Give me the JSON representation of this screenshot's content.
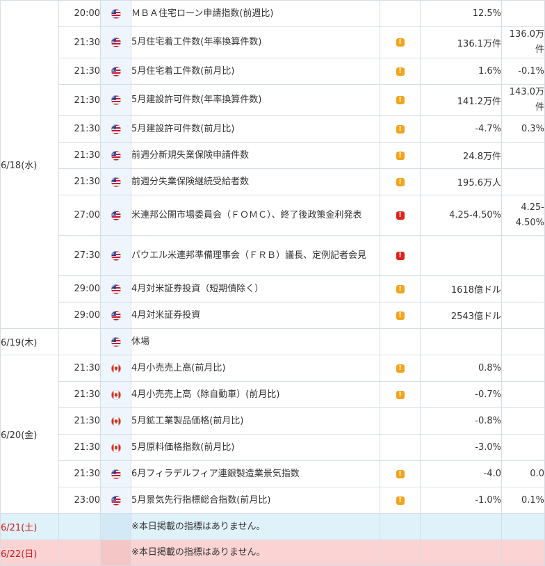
{
  "colors": {
    "border": "#d6dde6",
    "flag_column": "#eef5fc",
    "saturday_bg": "#dff1f9",
    "sunday_bg": "#fbd3d3",
    "weekend_date_text": "#d61a1a",
    "importance_mid": "#f4a31b",
    "importance_high": "#e0221c"
  },
  "rows": [
    {
      "date": "6/18(水)",
      "time": "20:00",
      "country": "us-flag-icon",
      "name": "ＭＢＡ住宅ローン申請指数(前週比)",
      "importance": "",
      "previous": "12.5%",
      "forecast": ""
    },
    {
      "date": "",
      "time": "21:30",
      "country": "us-flag-icon",
      "name": "5月住宅着工件数(年率換算件数)",
      "importance": "mid",
      "previous": "136.1万件",
      "forecast": "136.0万件"
    },
    {
      "date": "",
      "time": "21:30",
      "country": "us-flag-icon",
      "name": "5月住宅着工件数(前月比)",
      "importance": "mid",
      "previous": "1.6%",
      "forecast": "-0.1%"
    },
    {
      "date": "",
      "time": "21:30",
      "country": "us-flag-icon",
      "name": "5月建設許可件数(年率換算件数)",
      "importance": "mid",
      "previous": "141.2万件",
      "forecast": "143.0万件"
    },
    {
      "date": "",
      "time": "21:30",
      "country": "us-flag-icon",
      "name": "5月建設許可件数(前月比)",
      "importance": "mid",
      "previous": "-4.7%",
      "forecast": "0.3%"
    },
    {
      "date": "",
      "time": "21:30",
      "country": "us-flag-icon",
      "name": "前週分新規失業保険申請件数",
      "importance": "mid",
      "previous": "24.8万件",
      "forecast": ""
    },
    {
      "date": "",
      "time": "21:30",
      "country": "us-flag-icon",
      "name": "前週分失業保険継続受給者数",
      "importance": "mid",
      "previous": "195.6万人",
      "forecast": ""
    },
    {
      "date": "",
      "time": "27:00",
      "country": "us-flag-icon",
      "name": "米連邦公開市場委員会（ＦＯＭＣ）、終了後政策金利発表",
      "importance": "high",
      "previous": "4.25-4.50%",
      "forecast": "4.25-4.50%"
    },
    {
      "date": "",
      "time": "27:30",
      "country": "us-flag-icon",
      "name": "パウエル米連邦準備理事会（ＦＲＢ）議長、定例記者会見",
      "importance": "high",
      "previous": "",
      "forecast": ""
    },
    {
      "date": "",
      "time": "29:00",
      "country": "us-flag-icon",
      "name": "4月対米証券投資（短期債除く）",
      "importance": "mid",
      "previous": "1618億ドル",
      "forecast": ""
    },
    {
      "date": "",
      "time": "29:00",
      "country": "us-flag-icon",
      "name": "4月対米証券投資",
      "importance": "mid",
      "previous": "2543億ドル",
      "forecast": ""
    },
    {
      "date": "6/19(木)",
      "time": "",
      "country": "us-flag-icon",
      "name": "休場",
      "importance": "",
      "previous": "",
      "forecast": ""
    },
    {
      "date": "6/20(金)",
      "time": "21:30",
      "country": "ca-flag-icon",
      "name": "4月小売売上高(前月比)",
      "importance": "mid",
      "previous": "0.8%",
      "forecast": ""
    },
    {
      "date": "",
      "time": "21:30",
      "country": "ca-flag-icon",
      "name": "4月小売売上高（除自動車）(前月比)",
      "importance": "mid",
      "previous": "-0.7%",
      "forecast": ""
    },
    {
      "date": "",
      "time": "21:30",
      "country": "ca-flag-icon",
      "name": "5月鉱工業製品価格(前月比)",
      "importance": "",
      "previous": "-0.8%",
      "forecast": ""
    },
    {
      "date": "",
      "time": "21:30",
      "country": "ca-flag-icon",
      "name": "5月原料価格指数(前月比)",
      "importance": "",
      "previous": "-3.0%",
      "forecast": ""
    },
    {
      "date": "",
      "time": "21:30",
      "country": "us-flag-icon",
      "name": "6月フィラデルフィア連銀製造業景気指数",
      "importance": "mid",
      "previous": "-4.0",
      "forecast": "0.0"
    },
    {
      "date": "",
      "time": "23:00",
      "country": "us-flag-icon",
      "name": "5月景気先行指標総合指数(前月比)",
      "importance": "mid",
      "previous": "-1.0%",
      "forecast": "0.1%"
    },
    {
      "date": "6/21(土)",
      "time": "",
      "country": "",
      "name": "※本日掲載の指標はありません。",
      "importance": "",
      "previous": "",
      "forecast": "",
      "weekend": "sat"
    },
    {
      "date": "6/22(日)",
      "time": "",
      "country": "",
      "name": "※本日掲載の指標はありません。",
      "importance": "",
      "previous": "",
      "forecast": "",
      "weekend": "sun"
    }
  ]
}
